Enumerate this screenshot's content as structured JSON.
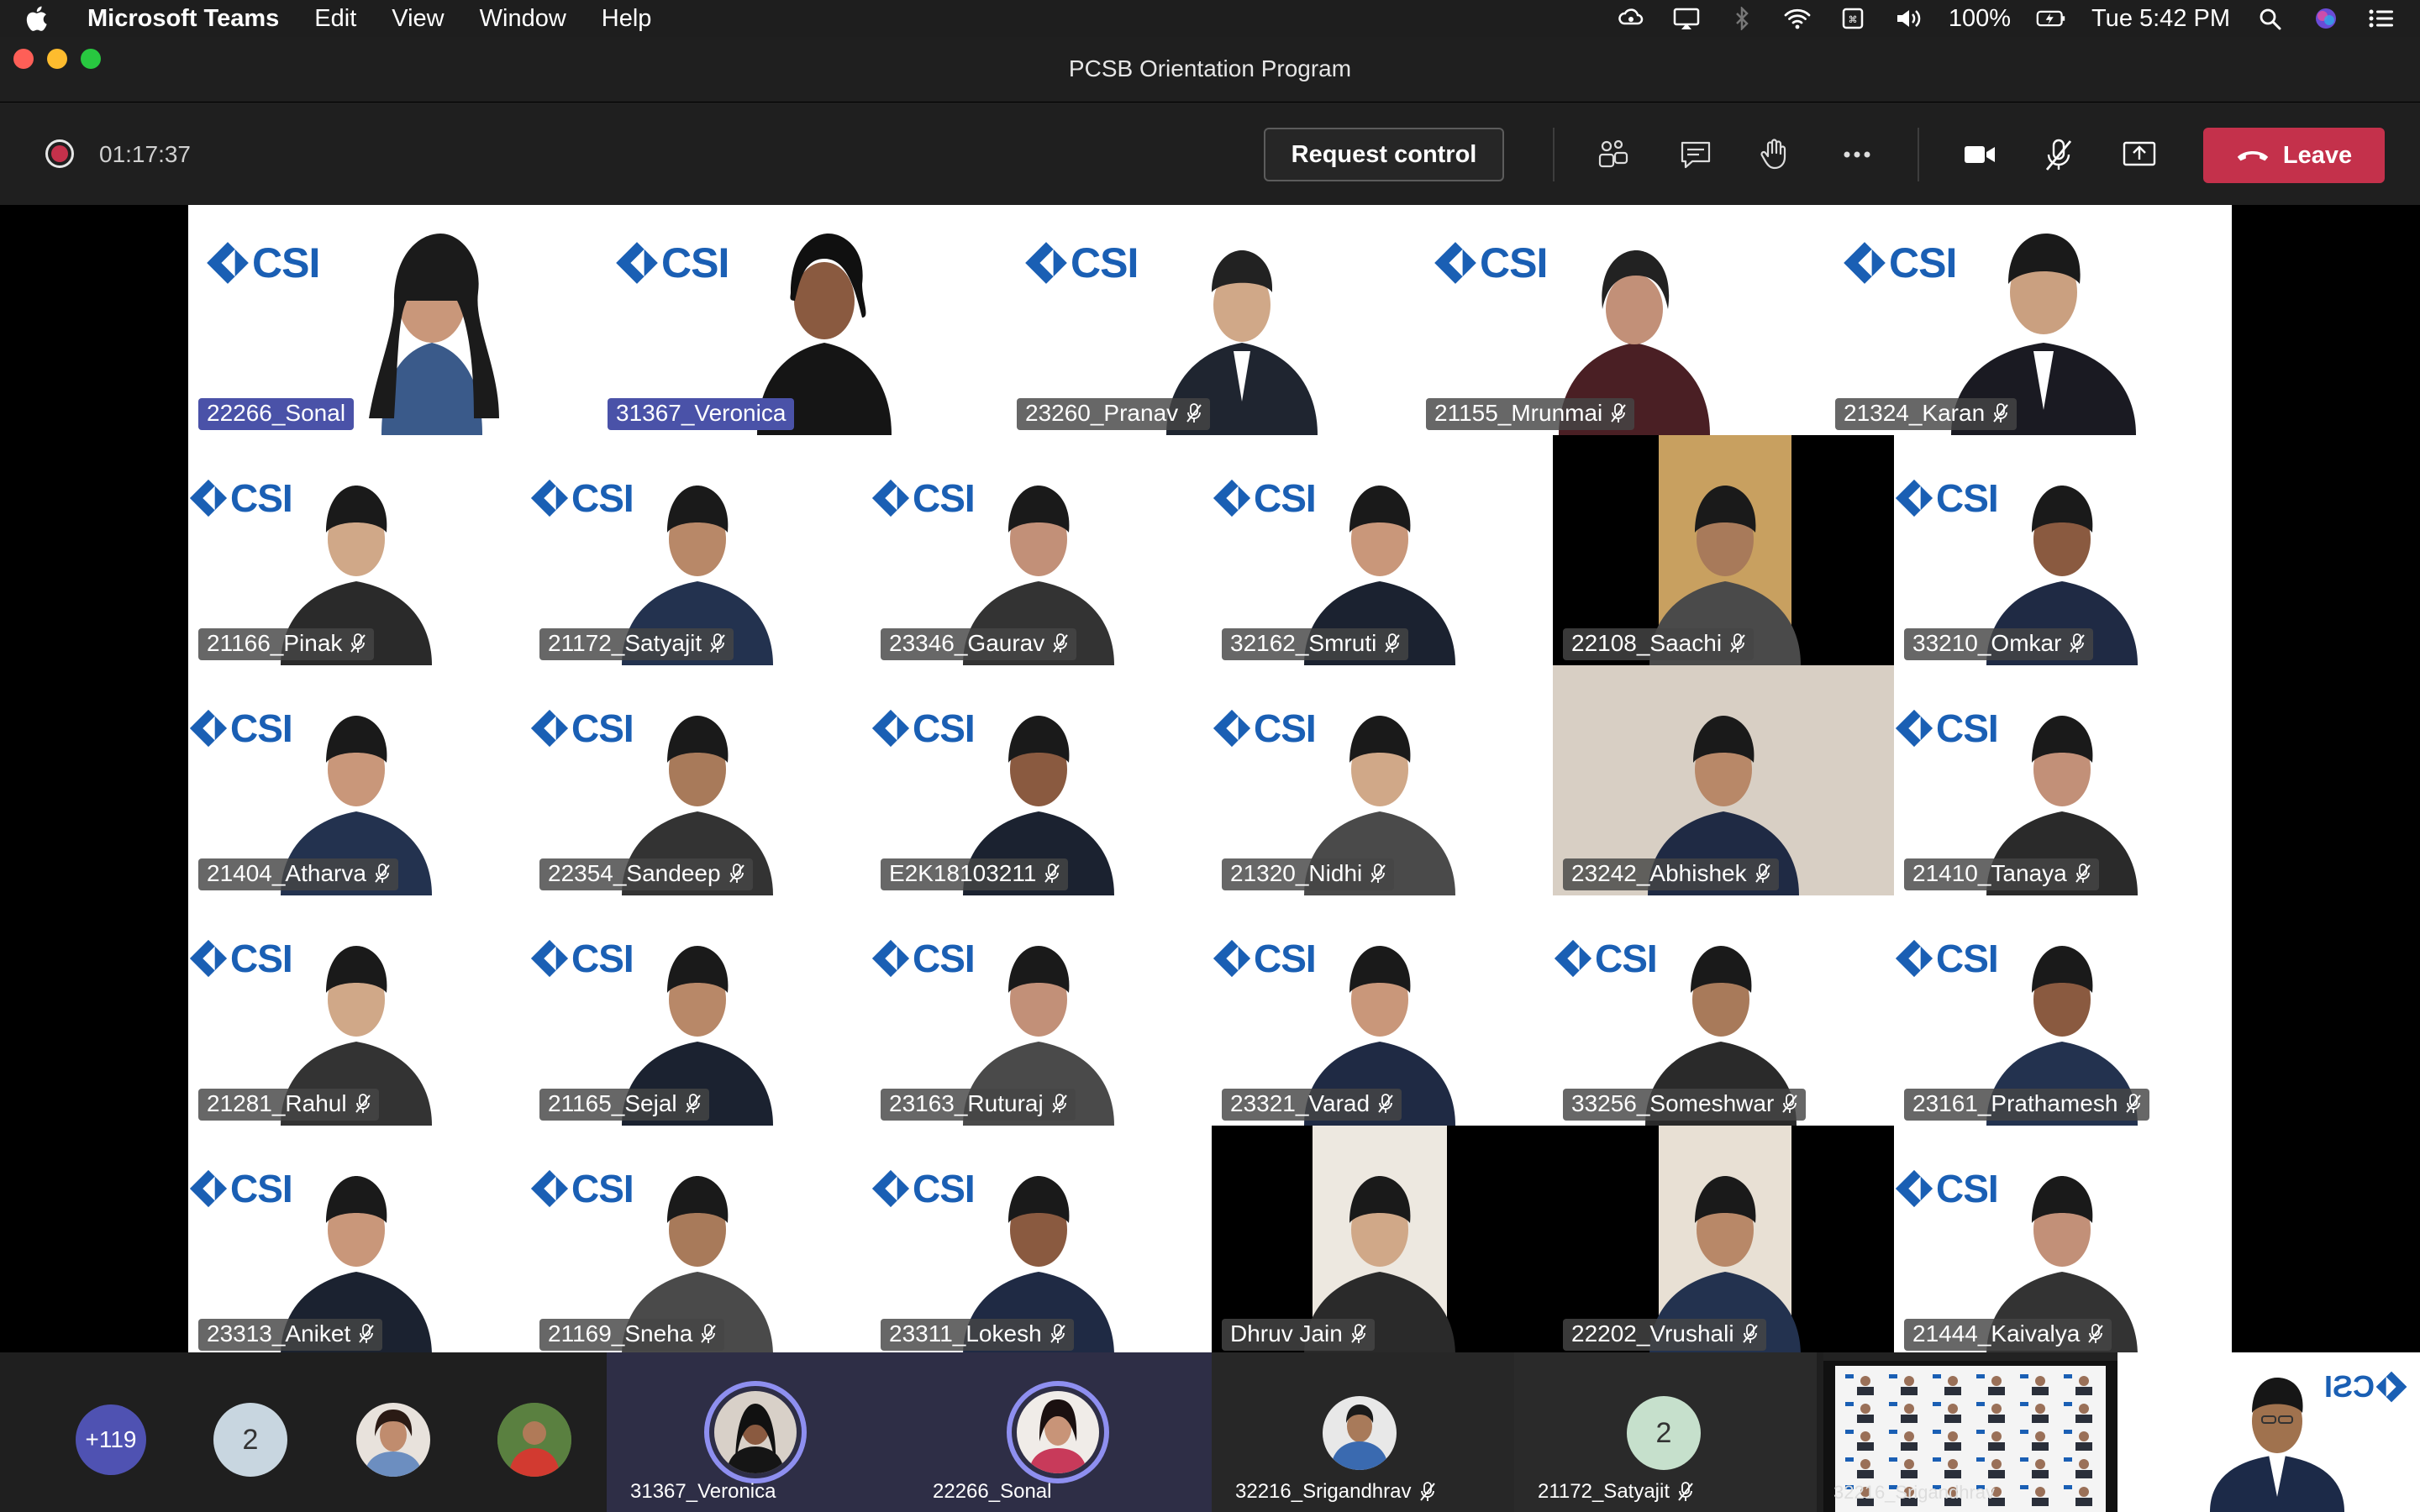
{
  "menubar": {
    "app": "Microsoft Teams",
    "items": [
      "Edit",
      "View",
      "Window",
      "Help"
    ],
    "battery": "100%",
    "clock": "Tue 5:42 PM"
  },
  "window": {
    "title": "PCSB Orientation Program"
  },
  "toolbar": {
    "timer": "01:17:37",
    "request_control": "Request control",
    "leave": "Leave",
    "colors": {
      "leave": "#c4314b",
      "speaking_ring": "#8e8ff0",
      "overflow_badge": "#4f52b2"
    }
  },
  "gallery": {
    "logo_text": "CSI",
    "rows": [
      [
        "22266_Sonal",
        "31367_Veronica",
        "23260_Pranav",
        "21155_Mrunmai",
        "21324_Karan"
      ],
      [
        "21166_Pinak",
        "21172_Satyajit",
        "23346_Gaurav",
        "32162_Smruti",
        "22108_Saachi",
        "33210_Omkar"
      ],
      [
        "21404_Atharva",
        "22354_Sandeep",
        "E2K18103211",
        "21320_Nidhi",
        "23242_Abhishek",
        "21410_Tanaya"
      ],
      [
        "21281_Rahul",
        "21165_Sejal",
        "23163_Ruturaj",
        "23321_Varad",
        "33256_Someshwar",
        "23161_Prathamesh"
      ],
      [
        "23313_Aniket",
        "21169_Sneha",
        "23311_Lokesh",
        "Dhruv Jain",
        "22202_Vrushali",
        "21444_Kaivalya"
      ]
    ]
  },
  "strip": {
    "overflow": "+119",
    "count_a": "2",
    "speaker_1": "31367_Veronica",
    "speaker_2": "22266_Sonal",
    "participant_3": "32216_Srigandhrav",
    "participant_4": "21172_Satyajit",
    "count_b": "2",
    "self_view": "32216_Srigandhrav"
  }
}
